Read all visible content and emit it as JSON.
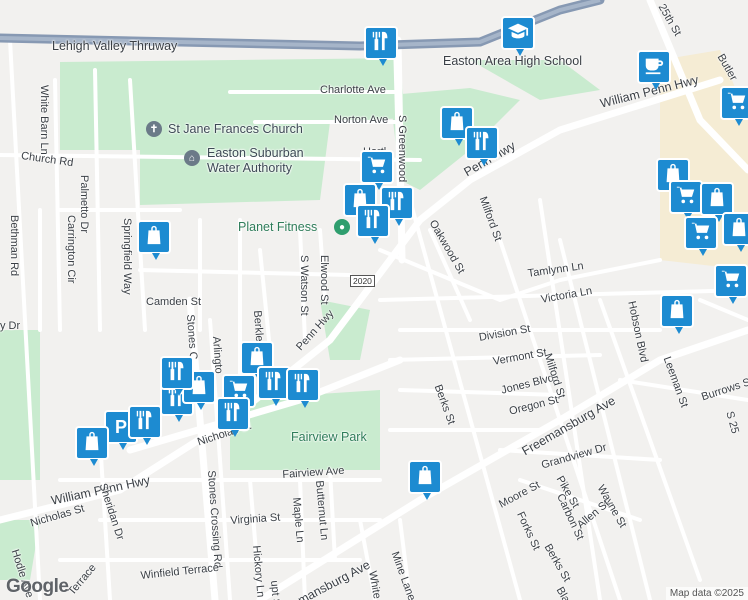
{
  "map": {
    "attribution": "Map data ©2025",
    "logo": "Google",
    "highway_shield": "2020",
    "colors": {
      "park": "#c9ebcf",
      "road": "#ffffff",
      "highway": "#8799b3",
      "pin": "#1d8bd1",
      "school_area": "#f5ecd4"
    }
  },
  "labels": {
    "lehigh_valley_thruway": "Lehigh Valley Thruway",
    "easton_area_high_school": "Easton Area High School",
    "charlotte_ave": "Charlotte Ave",
    "norton_ave": "Norton Ave",
    "st_jane_frances_church": "St Jane Frances Church",
    "easton_suburban_water_authority_1": "Easton Suburban",
    "easton_suburban_water_authority_2": "Water Authority",
    "church_rd": "Church Rd",
    "hartley_ave": "Hartl",
    "white_barn_ln": "White Barn Ln",
    "palmetto_dr": "Palmetto Dr",
    "carrington_cir": "Carrington Cir",
    "springfield_way": "Springfield Way",
    "bethman_rd": "Bethman Rd",
    "planet_fitness": "Planet Fitness",
    "elwood_st": "Elwood St",
    "s_watson_st": "S Watson St",
    "camden_st": "Camden St",
    "penn_hwy_center": "Penn Hwy",
    "s_greenwood": "S Greenwood",
    "william_penn_hwy_ne": "William Penn Hwy",
    "penn_hwy_mid": "Penn Hwy",
    "twentyfifth_st": "25th St",
    "butler_st": "Butler",
    "milford_st": "Milford St",
    "oakwood_st": "Oakwood St",
    "tamlynn_ln": "Tamlynn Ln",
    "victoria_ln": "Victoria Ln",
    "hobson_blvd": "Hobson Blvd",
    "division_st": "Division St",
    "vermont_st": "Vermont St",
    "jones_blvd": "Jones Blvd",
    "milford_st_2": "Milford St",
    "oregon_st": "Oregon St",
    "freemansburg_ave": "Freemansburg Ave",
    "leeman_st": "Leeman St",
    "burrows_st": "Burrows St",
    "berks_st": "Berks St",
    "grandview_dr": "Grandview Dr",
    "moore_st": "Moore St",
    "pike_st": "Pike St",
    "wayne_st": "Wayne St",
    "carbon_st": "Carbon St",
    "forks_st": "Forks St",
    "allen_st": "Allen St",
    "berks_st_2": "Berks St",
    "fairview_park": "Fairview Park",
    "nicholas_st": "Nicholas St",
    "fairview_ave": "Fairview Ave",
    "william_penn_hwy_sw": "William Penn Hwy",
    "nicholas_st_2": "Nicholas St",
    "sheridan_dr": "Sheridan Dr",
    "hodle_ave": "Hodle Ave",
    "virginia_st": "Virginia St",
    "maple_ln": "Maple Ln",
    "butternut_ln": "Butternut Ln",
    "hickory_ln": "Hickory Ln",
    "stones_crossing_rd": "Stones Crossing Rd",
    "stones_crossing_short": "Stones C",
    "arlington": "Arlingto",
    "berkley": "Berkle",
    "winfield_terrace": "Winfield Terrace",
    "terrace": "Terrace",
    "freemansburg_ave_sw": "mansburg Ave",
    "white": "White",
    "mine_lane": "Mine Lane",
    "dr_left": "y Dr",
    "hupt": "upt St",
    "blair": "Bla",
    "s_25th": "S 25"
  },
  "pins": [
    {
      "icon": "restaurant-icon",
      "name": "restaurant-pin-top"
    },
    {
      "icon": "school-icon",
      "name": "school-pin"
    },
    {
      "icon": "cafe-icon",
      "name": "cafe-pin"
    },
    {
      "icon": "shopping-bag-icon",
      "name": "shopping-pin-greenwood"
    },
    {
      "icon": "restaurant-icon",
      "name": "restaurant-pin-greenwood"
    },
    {
      "icon": "shopping-cart-icon",
      "name": "grocery-pin-far-right"
    },
    {
      "icon": "shopping-cart-icon",
      "name": "grocery-pin-hartley"
    },
    {
      "icon": "shopping-bag-icon",
      "name": "shopping-pin-fitness"
    },
    {
      "icon": "restaurant-icon",
      "name": "restaurant-pin-fitness-1"
    },
    {
      "icon": "restaurant-icon",
      "name": "restaurant-pin-fitness-2"
    },
    {
      "icon": "shopping-bag-icon",
      "name": "shopping-pin-springfield"
    },
    {
      "icon": "shopping-bag-icon",
      "name": "shopping-pin-cluster-right-1"
    },
    {
      "icon": "shopping-cart-icon",
      "name": "grocery-pin-cluster-right"
    },
    {
      "icon": "shopping-bag-icon",
      "name": "shopping-pin-cluster-right-2"
    },
    {
      "icon": "shopping-cart-icon",
      "name": "grocery-pin-cluster-right-2"
    },
    {
      "icon": "shopping-bag-icon",
      "name": "shopping-pin-cluster-right-3"
    },
    {
      "icon": "shopping-cart-icon",
      "name": "grocery-pin-right-edge"
    },
    {
      "icon": "shopping-bag-icon",
      "name": "shopping-pin-freemansburg"
    },
    {
      "icon": "shopping-bag-icon",
      "name": "shopping-pin-berks-south"
    },
    {
      "icon": "shopping-bag-icon",
      "name": "shopping-pin-penn-cluster"
    },
    {
      "icon": "shopping-cart-icon",
      "name": "grocery-pin-penn-cluster"
    },
    {
      "icon": "restaurant-icon",
      "name": "restaurant-pin-penn-1"
    },
    {
      "icon": "restaurant-icon",
      "name": "restaurant-pin-penn-2"
    },
    {
      "icon": "restaurant-icon",
      "name": "restaurant-pin-penn-3"
    },
    {
      "icon": "restaurant-icon",
      "name": "restaurant-pin-nicholas"
    },
    {
      "icon": "shopping-bag-icon",
      "name": "shopping-pin-west-cluster-1"
    },
    {
      "icon": "parking-icon",
      "name": "parking-pin-west"
    },
    {
      "icon": "restaurant-icon",
      "name": "restaurant-pin-west"
    },
    {
      "icon": "shopping-bag-icon",
      "name": "shopping-pin-west-cluster-2"
    },
    {
      "icon": "restaurant-icon",
      "name": "restaurant-pin-west-2"
    }
  ]
}
